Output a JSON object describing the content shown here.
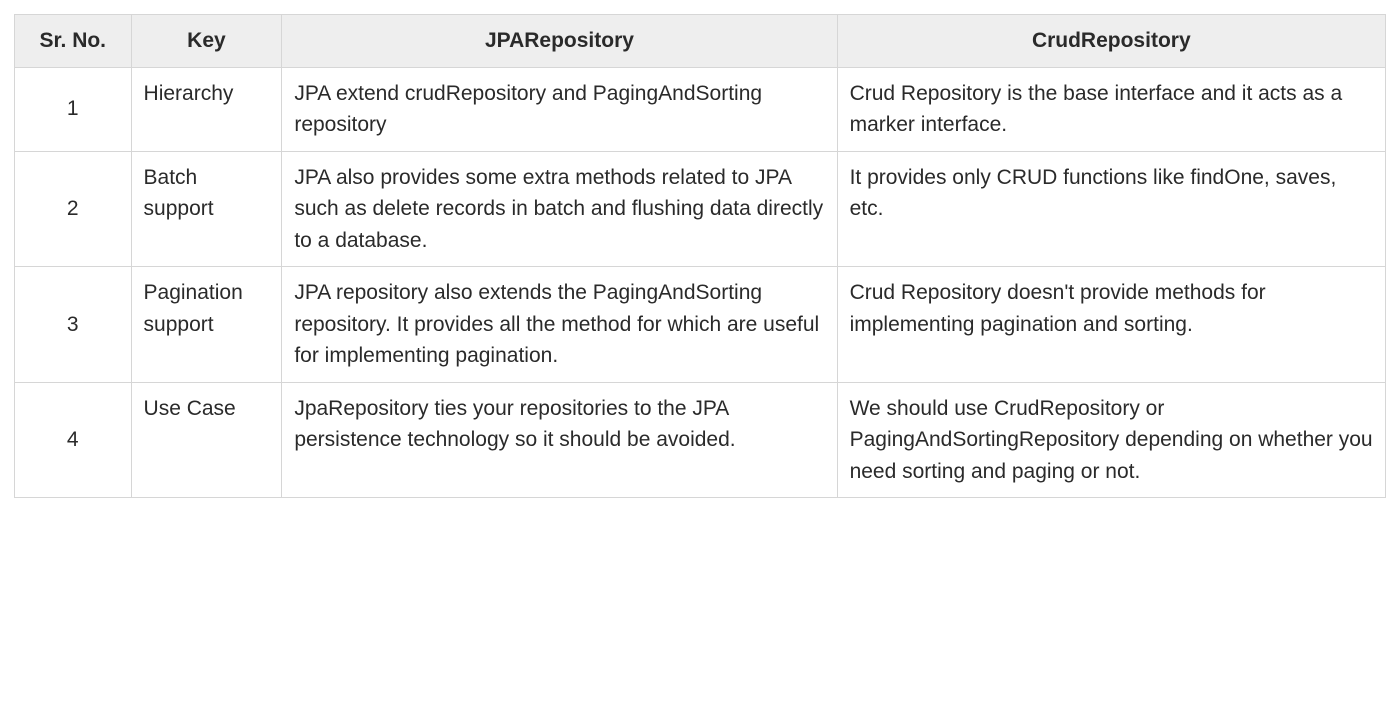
{
  "table": {
    "headers": {
      "srno": "Sr. No.",
      "key": "Key",
      "jpa": "JPARepository",
      "crud": "CrudRepository"
    },
    "rows": [
      {
        "srno": "1",
        "key": "Hierarchy",
        "jpa": "JPA extend crudRepository and PagingAndSorting repository",
        "crud": "Crud Repository is the base interface and it acts as a marker interface."
      },
      {
        "srno": "2",
        "key": "Batch support",
        "jpa": "JPA also provides some extra methods related to JPA such as delete records in batch and flushing data directly to a database.",
        "crud": "It provides only CRUD functions like findOne, saves, etc."
      },
      {
        "srno": "3",
        "key": "Pagination support",
        "jpa": "JPA repository also extends the PagingAndSorting repository. It provides all the method for which are useful for implementing pagination.",
        "crud": "Crud Repository doesn't provide methods for implementing pagination and sorting."
      },
      {
        "srno": "4",
        "key": " Use Case",
        "jpa": "JpaRepository ties your repositories to the JPA persistence technology so it should be avoided.",
        "crud": "We should use CrudRepository or PagingAndSortingRepository depending on whether you need sorting and paging or not."
      }
    ]
  }
}
